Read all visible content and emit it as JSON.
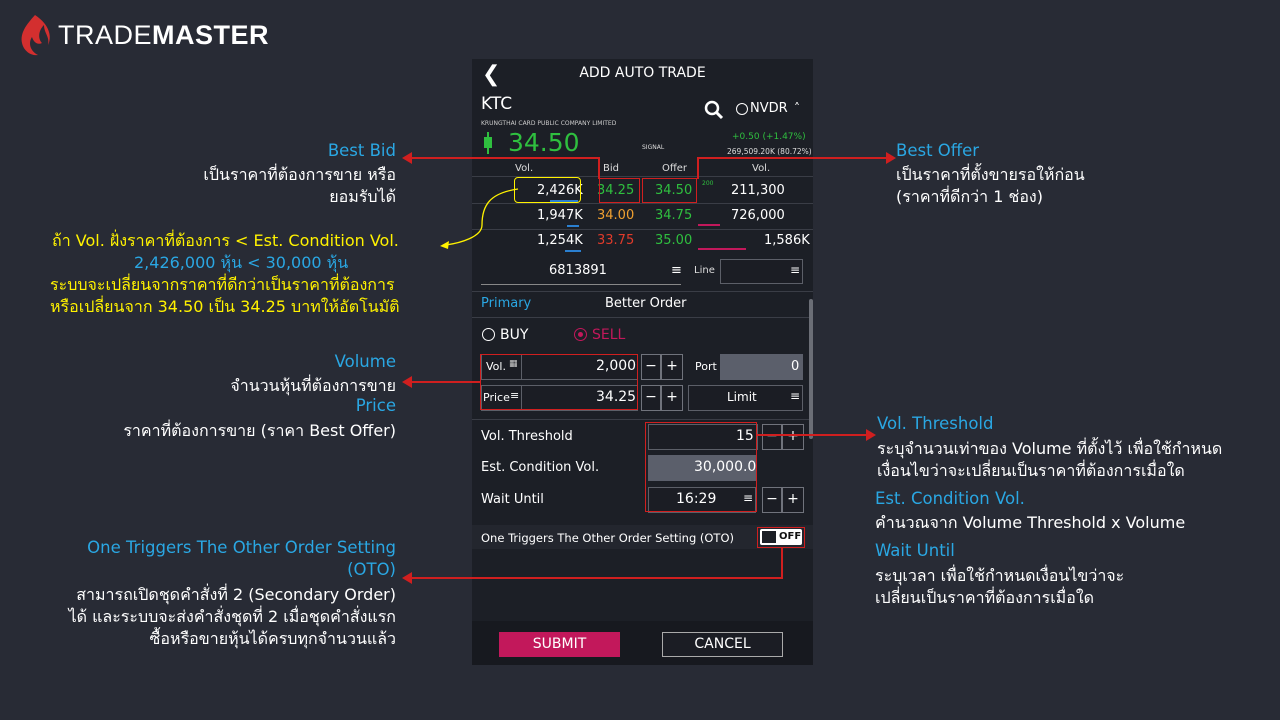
{
  "brand": {
    "name_light": "TRADE",
    "name_bold": "MASTER"
  },
  "screen": {
    "title": "ADD AUTO TRADE",
    "symbol": "KTC",
    "company": "KRUNGTHAI CARD PUBLIC COMPANY LIMITED",
    "nvdr_label": "NVDR",
    "price": "34.50",
    "signal": "SIGNAL",
    "change": "+0.50 (+1.47%)",
    "volume_info": "269,509.20K (80.72%)",
    "book_headers": [
      "Vol.",
      "Bid",
      "Offer",
      "Vol."
    ],
    "book_rows": [
      {
        "bid_vol": "2,426K",
        "bid": "34.25",
        "offer": "34.50",
        "offer_vol": "211,300",
        "tag": "200"
      },
      {
        "bid_vol": "1,947K",
        "bid": "34.00",
        "offer": "34.75",
        "offer_vol": "726,000",
        "tag": ""
      },
      {
        "bid_vol": "1,254K",
        "bid": "33.75",
        "offer": "35.00",
        "offer_vol": "1,586K",
        "tag": ""
      }
    ],
    "account": "6813891",
    "line_label": "Line",
    "tab_primary": "Primary",
    "tab_better": "Better Order",
    "buy_label": "BUY",
    "sell_label": "SELL",
    "vol_label": "Vol.",
    "vol_value": "2,000",
    "port_label": "Port",
    "port_value": "0",
    "price_label": "Price",
    "price_value": "34.25",
    "order_type": "Limit",
    "vol_threshold_label": "Vol. Threshold",
    "vol_threshold_value": "15",
    "est_label": "Est. Condition Vol.",
    "est_value": "30,000.0",
    "wait_label": "Wait Until",
    "wait_value": "16:29",
    "oto_label": "One Triggers The Other Order Setting (OTO)",
    "oto_toggle": "OFF",
    "submit": "SUBMIT",
    "cancel": "CANCEL",
    "minus": "−",
    "plus": "+",
    "colors": {
      "green": "#2fbf3f",
      "red": "#e03b2b",
      "orange": "#f0a030",
      "blue": "#2aa7e3",
      "submit": "#c2185b"
    }
  },
  "annotations": {
    "best_bid_title": "Best Bid",
    "best_bid_1": "เป็นราคาที่ต้องการขาย หรือ",
    "best_bid_2": "ยอมรับได้",
    "cond_1": "ถ้า Vol. ฝั่งราคาที่ต้องการ < Est. Condition Vol.",
    "cond_2": "2,426,000 หุ้น < 30,000 หุ้น",
    "cond_3": "ระบบจะเปลี่ยนจากราคาที่ดีกว่าเป็นราคาที่ต้องการ",
    "cond_4": "หรือเปลี่ยนจาก 34.50 เป็น 34.25 บาทให้อัตโนมัติ",
    "volume_title": "Volume",
    "volume_desc": "จำนวนหุ้นที่ต้องการขาย",
    "price_title": "Price",
    "price_desc": "ราคาที่ต้องการขาย (ราคา Best Offer)",
    "oto_title_1": "One Triggers The Other Order Setting",
    "oto_title_2": "(OTO)",
    "oto_desc_1": "สามารถเปิดชุดคำสั่งที่ 2 (Secondary Order)",
    "oto_desc_2": "ได้ และระบบจะส่งคำสั่งชุดที่ 2 เมื่อชุดคำสั่งแรก",
    "oto_desc_3": "ซื้อหรือขายหุ้นได้ครบทุกจำนวนแล้ว",
    "best_offer_title": "Best Offer",
    "best_offer_1": "เป็นราคาที่ตั้งขายรอให้ก่อน",
    "best_offer_2": "(ราคาที่ดีกว่า 1 ช่อง)",
    "vt_title": "Vol. Threshold",
    "vt_1": "ระบุจำนวนเท่าของ Volume ที่ตั้งไว้ เพื่อใช้กำหนด",
    "vt_2": "เงื่อนไขว่าจะเปลี่ยนเป็นราคาที่ต้องการเมื่อใด",
    "est_title": "Est. Condition Vol.",
    "est_1": "คำนวณจาก Volume Threshold x Volume",
    "wait_title": "Wait Until",
    "wait_1": "ระบุเวลา เพื่อใช้กำหนดเงื่อนไขว่าจะ",
    "wait_2": "เปลี่ยนเป็นราคาที่ต้องการเมื่อใด"
  }
}
